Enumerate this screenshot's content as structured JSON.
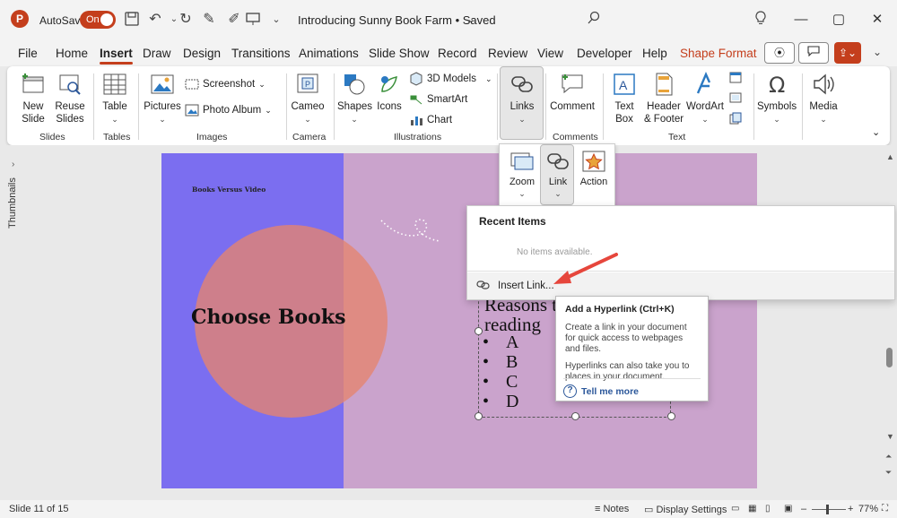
{
  "titlebar": {
    "app_logo": "P",
    "autosave_label": "AutoSave",
    "autosave_state": "On",
    "doc_title": "Introducing Sunny Book Farm • Saved",
    "icons": [
      "save-icon",
      "undo-icon",
      "redo-icon",
      "pen-icon",
      "present-icon",
      "search-icon",
      "lightbulb-icon",
      "minimize-icon",
      "maximize-icon",
      "close-icon"
    ]
  },
  "tabs": [
    "File",
    "Home",
    "Insert",
    "Draw",
    "Design",
    "Transitions",
    "Animations",
    "Slide Show",
    "Record",
    "Review",
    "View",
    "Developer",
    "Help",
    "Shape Format"
  ],
  "active_tab": "Insert",
  "ribbon": {
    "slides": {
      "label": "Slides",
      "new_slide": "New\nSlide",
      "new_slide_1": "New",
      "new_slide_2": "Slide",
      "reuse_1": "Reuse",
      "reuse_2": "Slides"
    },
    "tables": {
      "label": "Tables",
      "table": "Table"
    },
    "images": {
      "label": "Images",
      "pictures": "Pictures",
      "screenshot": "Screenshot",
      "photo_album": "Photo Album"
    },
    "camera": {
      "label": "Camera",
      "cameo": "Cameo"
    },
    "illustrations": {
      "label": "Illustrations",
      "shapes": "Shapes",
      "icons": "Icons",
      "models": "3D Models",
      "smartart": "SmartArt",
      "chart": "Chart"
    },
    "links": {
      "label": "Links"
    },
    "comments": {
      "label": "Comments",
      "comment": "Comment"
    },
    "text": {
      "label": "Text",
      "textbox_1": "Text",
      "textbox_2": "Box",
      "header_1": "Header",
      "header_2": "& Footer",
      "wordart": "WordArt"
    },
    "symbols": {
      "label": "Symbols"
    },
    "media": {
      "label": "Media"
    }
  },
  "link_dropdown": {
    "zoom": "Zoom",
    "link": "Link",
    "action": "Action"
  },
  "recent_panel": {
    "title": "Recent Items",
    "empty": "No items available.",
    "insert_link": "Insert Link..."
  },
  "tooltip": {
    "title": "Add a Hyperlink (Ctrl+K)",
    "body1": "Create a link in your document for quick access to webpages and files.",
    "body2": "Hyperlinks can also take you to places in your document.",
    "more": "Tell me more"
  },
  "slide": {
    "small_title": "Books Versus Video",
    "main_title": "Choose Books",
    "text_line1": "Reasons t",
    "text_line2": "reading",
    "list": [
      "A",
      "B",
      "C",
      "D"
    ]
  },
  "sidebar": {
    "thumbnails": "Thumbnails"
  },
  "statusbar": {
    "slide_info": "Slide 11 of 15",
    "notes": "Notes",
    "display_settings": "Display Settings",
    "zoom": "77%"
  },
  "colors": {
    "accent": "#c43e1c",
    "slide_blue": "#7b6ef0",
    "slide_purple": "#caa3cc",
    "circle": "#e6846e"
  }
}
